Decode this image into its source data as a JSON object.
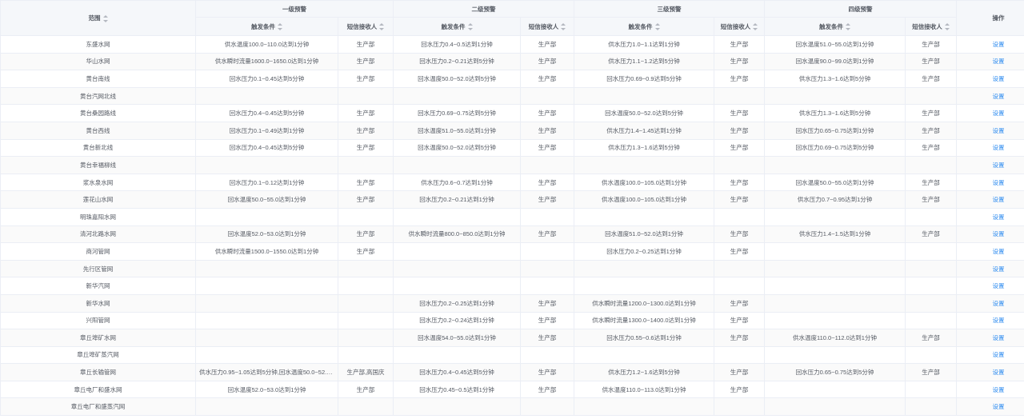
{
  "header": {
    "range": "范围",
    "levels": [
      "一级预警",
      "二级预警",
      "三级预警",
      "四级预警"
    ],
    "condition": "触发条件",
    "receiver": "短信接收人",
    "ops": "操作"
  },
  "rows": [
    [
      "东盛水网",
      "供水温度100.0~110.0达到1分钟",
      "生产部",
      "回水压力0.4~0.5达到1分钟",
      "生产部",
      "供水压力1.0~1.1达到1分钟",
      "生产部",
      "回水温度51.0~55.0达到1分钟",
      "生产部",
      "设置"
    ],
    [
      "华山水网",
      "供水瞬时流量1600.0~1650.0达到1分钟",
      "生产部",
      "回水压力0.2~0.21达到5分钟",
      "生产部",
      "供水压力1.1~1.2达到5分钟",
      "生产部",
      "回水温度90.0~99.0达到1分钟",
      "生产部",
      "设置"
    ],
    [
      "黄台南线",
      "回水压力0.1~0.45达到5分钟",
      "生产部",
      "回水温度50.0~52.0达到5分钟",
      "生产部",
      "回水压力0.69~0.9达到5分钟",
      "生产部",
      "供水压力1.3~1.6达到5分钟",
      "生产部",
      "设置"
    ],
    [
      "黄台汽网北线",
      "",
      "",
      "",
      "",
      "",
      "",
      "",
      "",
      "设置"
    ],
    [
      "黄台桑园路线",
      "回水压力0.4~0.45达到5分钟",
      "生产部",
      "回水压力0.69~0.75达到5分钟",
      "生产部",
      "回水温度50.0~52.0达到5分钟",
      "生产部",
      "供水压力1.3~1.6达到5分钟",
      "生产部",
      "设置"
    ],
    [
      "黄台西线",
      "回水压力0.1~0.49达到1分钟",
      "生产部",
      "回水温度51.0~55.0达到1分钟",
      "生产部",
      "供水压力1.4~1.45达到1分钟",
      "生产部",
      "回水压力0.65~0.75达到1分钟",
      "生产部",
      "设置"
    ],
    [
      "黄台新北线",
      "回水压力0.4~0.45达到5分钟",
      "生产部",
      "回水温度50.0~52.0达到5分钟",
      "生产部",
      "供水压力1.3~1.6达到5分钟",
      "生产部",
      "回水压力0.69~0.75达到5分钟",
      "生产部",
      "设置"
    ],
    [
      "黄台幸福柳线",
      "",
      "",
      "",
      "",
      "",
      "",
      "",
      "",
      "设置"
    ],
    [
      "浆水泉水网",
      "回水压力0.1~0.12达到1分钟",
      "生产部",
      "供水压力0.6~0.7达到1分钟",
      "生产部",
      "供水温度100.0~105.0达到1分钟",
      "生产部",
      "回水温度50.0~55.0达到1分钟",
      "生产部",
      "设置"
    ],
    [
      "莲花山水网",
      "回水温度50.0~55.0达到1分钟",
      "生产部",
      "回水压力0.2~0.21达到1分钟",
      "生产部",
      "供水温度100.0~105.0达到1分钟",
      "生产部",
      "供水压力0.7~0.95达到1分钟",
      "生产部",
      "设置"
    ],
    [
      "明珠嘉阳水网",
      "",
      "",
      "",
      "",
      "",
      "",
      "",
      "",
      "设置"
    ],
    [
      "清河北路水网",
      "回水温度52.0~53.0达到1分钟",
      "生产部",
      "供水瞬时流量800.0~850.0达到1分钟",
      "生产部",
      "回水温度51.0~52.0达到1分钟",
      "生产部",
      "供水压力1.4~1.5达到1分钟",
      "生产部",
      "设置"
    ],
    [
      "商河管网",
      "供水瞬时流量1500.0~1550.0达到1分钟",
      "生产部",
      "",
      "",
      "回水压力0.2~0.25达到1分钟",
      "生产部",
      "",
      "",
      "设置"
    ],
    [
      "先行区管网",
      "",
      "",
      "",
      "",
      "",
      "",
      "",
      "",
      "设置"
    ],
    [
      "新华汽网",
      "",
      "",
      "",
      "",
      "",
      "",
      "",
      "",
      "设置"
    ],
    [
      "新华水网",
      "",
      "",
      "回水压力0.2~0.25达到1分钟",
      "生产部",
      "供水瞬时流量1200.0~1300.0达到1分钟",
      "生产部",
      "",
      "",
      "设置"
    ],
    [
      "兴阳管网",
      "",
      "",
      "回水压力0.2~0.24达到1分钟",
      "生产部",
      "供水瞬时流量1300.0~1400.0达到1分钟",
      "生产部",
      "",
      "",
      "设置"
    ],
    [
      "章丘埠矿水网",
      "",
      "",
      "回水温度54.0~55.0达到1分钟",
      "生产部",
      "回水压力0.55~0.6达到1分钟",
      "生产部",
      "供水温度110.0~112.0达到1分钟",
      "生产部",
      "设置"
    ],
    [
      "章丘埠矿蒸汽网",
      "",
      "",
      "",
      "",
      "",
      "",
      "",
      "",
      "设置"
    ],
    [
      "章丘长输管网",
      "供水压力0.95~1.05达到5分钟,回水温度50.0~52.0达到5分钟",
      "生产部,高国庆",
      "回水压力0.4~0.45达到5分钟",
      "生产部",
      "供水压力1.2~1.6达到5分钟",
      "生产部",
      "回水压力0.65~0.75达到5分钟",
      "生产部",
      "设置"
    ],
    [
      "章丘电厂和盛水网",
      "回水温度52.0~53.0达到1分钟",
      "生产部",
      "回水压力0.45~0.5达到1分钟",
      "生产部",
      "供水温度110.0~113.0达到1分钟",
      "生产部",
      "",
      "",
      "设置"
    ],
    [
      "章丘电厂和盛蒸汽网",
      "",
      "",
      "",
      "",
      "",
      "",
      "",
      "",
      "设置"
    ]
  ]
}
